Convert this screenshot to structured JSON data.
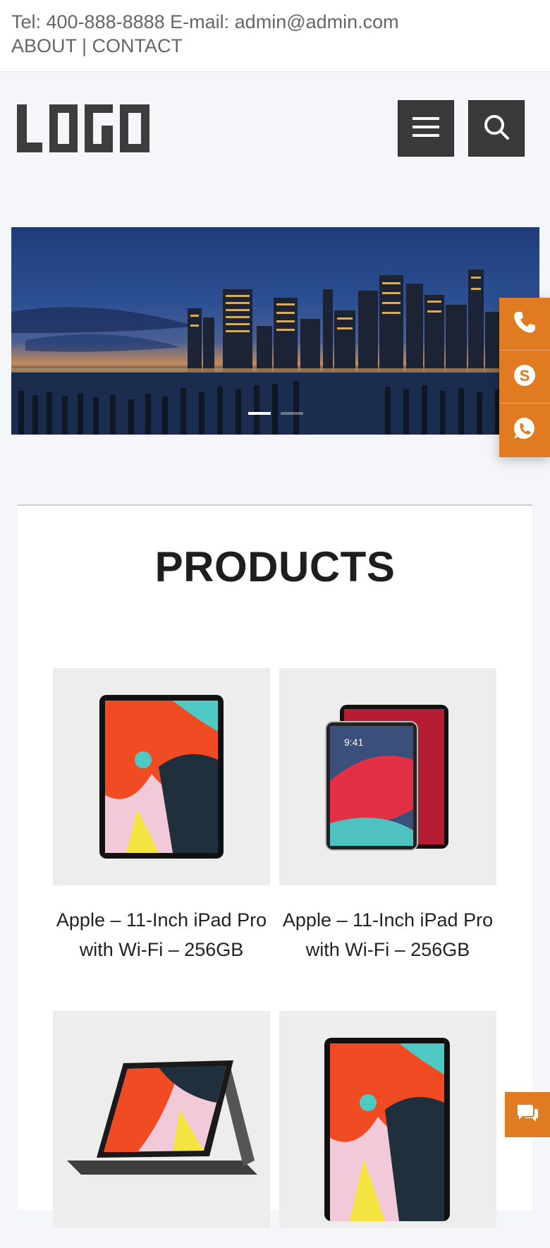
{
  "topbar": {
    "contact_line": "Tel: 400-888-8888 E-mail: admin@admin.com",
    "links": "ABOUT | CONTACT"
  },
  "header": {
    "logo_text": "LOGO",
    "menu_icon": "hamburger-menu-icon",
    "search_icon": "search-icon"
  },
  "banner": {
    "slides": 2,
    "active_slide": 1
  },
  "float_contact": {
    "items": [
      "phone-icon",
      "skype-icon",
      "whatsapp-icon"
    ],
    "color": "#e07b22"
  },
  "products": {
    "title": "PRODUCTS",
    "items": [
      {
        "name": "Apple – 11-Inch iPad Pro with Wi-Fi – 256GB",
        "image": "ipad-pro-front"
      },
      {
        "name": "Apple – 11-Inch iPad Pro with Wi-Fi – 256GB",
        "image": "ipad-pro-pair"
      },
      {
        "name": "",
        "image": "ipad-pro-folio-case"
      },
      {
        "name": "",
        "image": "ipad-pro-front"
      }
    ]
  },
  "chat": {
    "icon": "chat-bubbles-icon"
  },
  "colors": {
    "accent": "#e07b22",
    "header_button": "#3a3a3a",
    "page_bg": "#f4f6f9"
  }
}
